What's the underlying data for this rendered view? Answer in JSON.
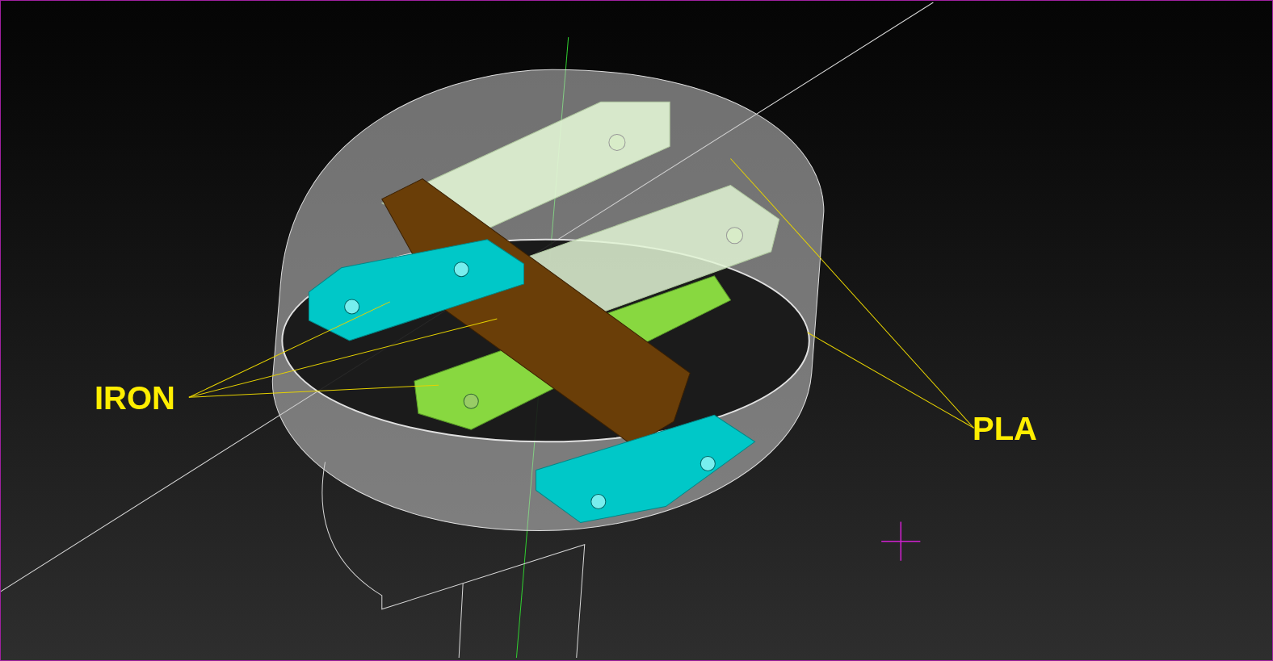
{
  "labels": [
    {
      "text": "IRON"
    },
    {
      "text": "PLA"
    }
  ]
}
